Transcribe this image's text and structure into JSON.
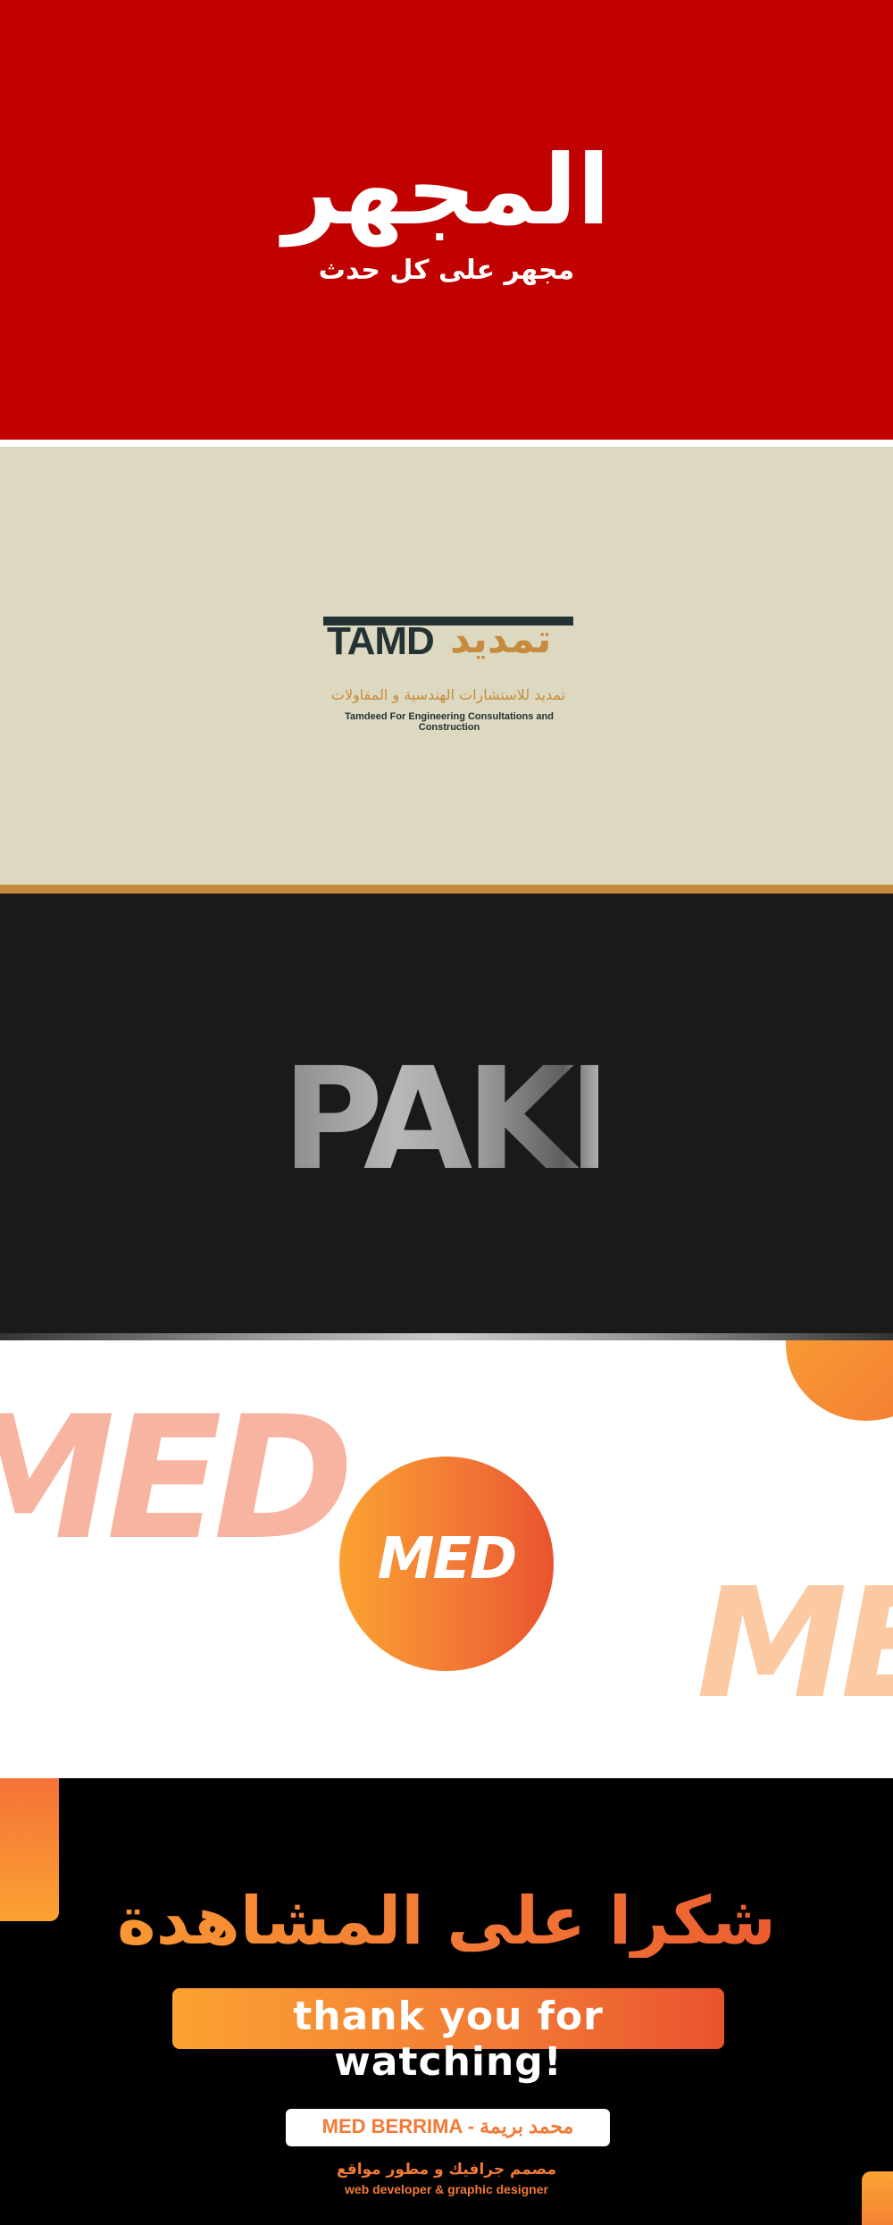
{
  "mujhir": {
    "title": "المجهر",
    "subtitle": "مجهر على كل حدث"
  },
  "tamdeed": {
    "latin_logo": "TAMD",
    "arabic_logo": "تمديد",
    "arabic_tagline": "تمديد للاستشارات الهندسية و المقاولات",
    "english_tagline": "Tamdeed For Engineering Consultations and Construction"
  },
  "paki": {
    "logo": "PAKI"
  },
  "med": {
    "circle_logo": "MED",
    "large_left": "MED",
    "large_right": "MED"
  },
  "thanks": {
    "arabic": "شكرا على المشاهدة",
    "english": "thank you for watching!",
    "name": "MED BERRIMA - محمد بريمة",
    "role_arabic": "مصمم جرافيك و مطور مواقع",
    "role_english": "web developer & graphic designer"
  },
  "colors": {
    "red_bg": "#c10000",
    "beige_bg": "#dcd9c0",
    "gold": "#c68b3e",
    "dark_teal": "#253234",
    "dark_bg": "#1a1a1a",
    "orange": "#f27a35",
    "orange_light": "#fba232",
    "orange_red": "#e9532f"
  }
}
